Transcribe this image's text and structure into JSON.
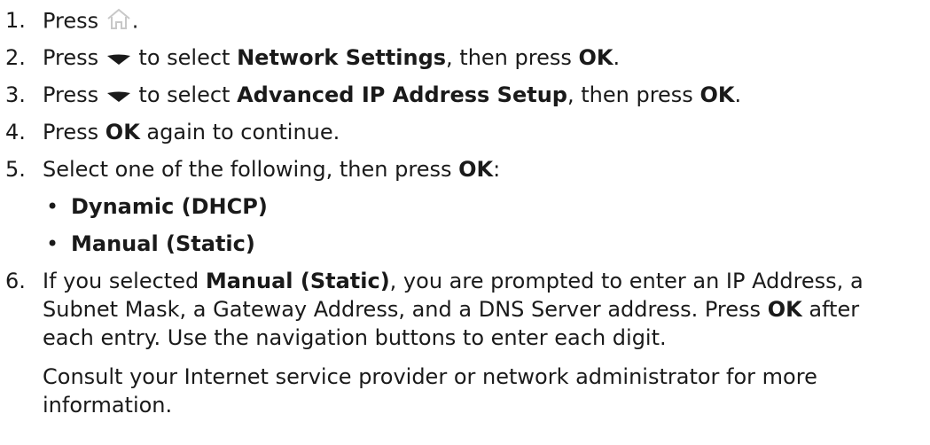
{
  "steps": [
    {
      "num": "1.",
      "pre": "Press ",
      "icon": "home-icon",
      "post": "."
    },
    {
      "num": "2.",
      "pre": "Press ",
      "icon": "down-arrow-icon",
      "mid": " to select ",
      "bold1": "Network Settings",
      "mid2": ", then press ",
      "bold2": "OK",
      "post": "."
    },
    {
      "num": "3.",
      "pre": "Press ",
      "icon": "down-arrow-icon",
      "mid": " to select ",
      "bold1": "Advanced IP Address Setup",
      "mid2": ", then press ",
      "bold2": "OK",
      "post": "."
    },
    {
      "num": "4.",
      "pre": "Press ",
      "bold1": "OK",
      "post": " again to continue."
    },
    {
      "num": "5.",
      "pre": "Select one of the following, then press ",
      "bold1": "OK",
      "post": ":"
    },
    {
      "num": "6.",
      "pre": "If you selected ",
      "bold1": "Manual (Static)",
      "line1_post": ", you are prompted to enter an IP Address, a",
      "line2_pre": "Subnet Mask, a Gateway Address, and a DNS Server address. Press ",
      "line2_bold": "OK",
      "line2_post": " after",
      "line3": "each entry. Use the navigation buttons to enter each digit."
    }
  ],
  "options": [
    {
      "bullet": "•",
      "label": "Dynamic (DHCP)"
    },
    {
      "bullet": "•",
      "label": "Manual (Static)"
    }
  ],
  "note": {
    "line1": "Consult your Internet service provider or network administrator for more",
    "line2": "information."
  }
}
